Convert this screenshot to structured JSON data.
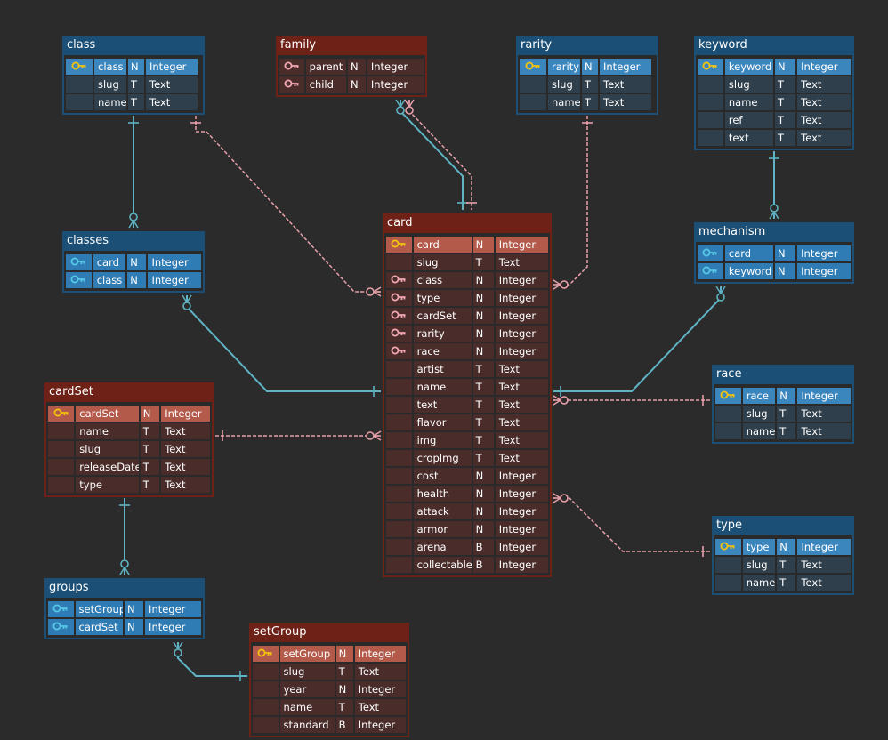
{
  "tables": [
    {
      "id": "class",
      "name": "class",
      "theme": "blue",
      "columns": [
        {
          "name": "class",
          "type": "N",
          "datatype": "Integer",
          "key": "pk"
        },
        {
          "name": "slug",
          "type": "T",
          "datatype": "Text",
          "key": ""
        },
        {
          "name": "name",
          "type": "T",
          "datatype": "Text",
          "key": ""
        }
      ]
    },
    {
      "id": "family",
      "name": "family",
      "theme": "red",
      "columns": [
        {
          "name": "parent",
          "type": "N",
          "datatype": "Integer",
          "key": "pkfk"
        },
        {
          "name": "child",
          "type": "N",
          "datatype": "Integer",
          "key": "fk"
        }
      ]
    },
    {
      "id": "rarity",
      "name": "rarity",
      "theme": "blue",
      "columns": [
        {
          "name": "rarity",
          "type": "N",
          "datatype": "Integer",
          "key": "pk"
        },
        {
          "name": "slug",
          "type": "T",
          "datatype": "Text",
          "key": ""
        },
        {
          "name": "name",
          "type": "T",
          "datatype": "Text",
          "key": ""
        }
      ]
    },
    {
      "id": "keyword",
      "name": "keyword",
      "theme": "blue",
      "columns": [
        {
          "name": "keyword",
          "type": "N",
          "datatype": "Integer",
          "key": "pk"
        },
        {
          "name": "slug",
          "type": "T",
          "datatype": "Text",
          "key": ""
        },
        {
          "name": "name",
          "type": "T",
          "datatype": "Text",
          "key": ""
        },
        {
          "name": "ref",
          "type": "T",
          "datatype": "Text",
          "key": ""
        },
        {
          "name": "text",
          "type": "T",
          "datatype": "Text",
          "key": ""
        }
      ]
    },
    {
      "id": "classes",
      "name": "classes",
      "theme": "blue",
      "columns": [
        {
          "name": "card",
          "type": "N",
          "datatype": "Integer",
          "key": "pkfk"
        },
        {
          "name": "class",
          "type": "N",
          "datatype": "Integer",
          "key": "pkfk"
        }
      ]
    },
    {
      "id": "card",
      "name": "card",
      "theme": "red",
      "columns": [
        {
          "name": "card",
          "type": "N",
          "datatype": "Integer",
          "key": "pk"
        },
        {
          "name": "slug",
          "type": "T",
          "datatype": "Text",
          "key": ""
        },
        {
          "name": "class",
          "type": "N",
          "datatype": "Integer",
          "key": "fk"
        },
        {
          "name": "type",
          "type": "N",
          "datatype": "Integer",
          "key": "fk"
        },
        {
          "name": "cardSet",
          "type": "N",
          "datatype": "Integer",
          "key": "fk"
        },
        {
          "name": "rarity",
          "type": "N",
          "datatype": "Integer",
          "key": "fk"
        },
        {
          "name": "race",
          "type": "N",
          "datatype": "Integer",
          "key": "fk"
        },
        {
          "name": "artist",
          "type": "T",
          "datatype": "Text",
          "key": ""
        },
        {
          "name": "name",
          "type": "T",
          "datatype": "Text",
          "key": ""
        },
        {
          "name": "text",
          "type": "T",
          "datatype": "Text",
          "key": ""
        },
        {
          "name": "flavor",
          "type": "T",
          "datatype": "Text",
          "key": ""
        },
        {
          "name": "img",
          "type": "T",
          "datatype": "Text",
          "key": ""
        },
        {
          "name": "cropImg",
          "type": "T",
          "datatype": "Text",
          "key": ""
        },
        {
          "name": "cost",
          "type": "N",
          "datatype": "Integer",
          "key": ""
        },
        {
          "name": "health",
          "type": "N",
          "datatype": "Integer",
          "key": ""
        },
        {
          "name": "attack",
          "type": "N",
          "datatype": "Integer",
          "key": ""
        },
        {
          "name": "armor",
          "type": "N",
          "datatype": "Integer",
          "key": ""
        },
        {
          "name": "arena",
          "type": "B",
          "datatype": "Integer",
          "key": ""
        },
        {
          "name": "collectable",
          "type": "B",
          "datatype": "Integer",
          "key": ""
        }
      ]
    },
    {
      "id": "mechanism",
      "name": "mechanism",
      "theme": "blue",
      "columns": [
        {
          "name": "card",
          "type": "N",
          "datatype": "Integer",
          "key": "pkfk"
        },
        {
          "name": "keyword",
          "type": "N",
          "datatype": "Integer",
          "key": "pkfk"
        }
      ]
    },
    {
      "id": "race",
      "name": "race",
      "theme": "blue",
      "columns": [
        {
          "name": "race",
          "type": "N",
          "datatype": "Integer",
          "key": "pk"
        },
        {
          "name": "slug",
          "type": "T",
          "datatype": "Text",
          "key": ""
        },
        {
          "name": "name",
          "type": "T",
          "datatype": "Text",
          "key": ""
        }
      ]
    },
    {
      "id": "cardSet",
      "name": "cardSet",
      "theme": "red",
      "columns": [
        {
          "name": "cardSet",
          "type": "N",
          "datatype": "Integer",
          "key": "pk"
        },
        {
          "name": "name",
          "type": "T",
          "datatype": "Text",
          "key": ""
        },
        {
          "name": "slug",
          "type": "T",
          "datatype": "Text",
          "key": ""
        },
        {
          "name": "releaseDate",
          "type": "T",
          "datatype": "Text",
          "key": ""
        },
        {
          "name": "type",
          "type": "T",
          "datatype": "Text",
          "key": ""
        }
      ]
    },
    {
      "id": "type",
      "name": "type",
      "theme": "blue",
      "columns": [
        {
          "name": "type",
          "type": "N",
          "datatype": "Integer",
          "key": "pk"
        },
        {
          "name": "slug",
          "type": "T",
          "datatype": "Text",
          "key": ""
        },
        {
          "name": "name",
          "type": "T",
          "datatype": "Text",
          "key": ""
        }
      ]
    },
    {
      "id": "groups",
      "name": "groups",
      "theme": "blue",
      "columns": [
        {
          "name": "setGroup",
          "type": "N",
          "datatype": "Integer",
          "key": "pkfk"
        },
        {
          "name": "cardSet",
          "type": "N",
          "datatype": "Integer",
          "key": "pkfk"
        }
      ]
    },
    {
      "id": "setGroup",
      "name": "setGroup",
      "theme": "red",
      "columns": [
        {
          "name": "setGroup",
          "type": "N",
          "datatype": "Integer",
          "key": "pk"
        },
        {
          "name": "slug",
          "type": "T",
          "datatype": "Text",
          "key": ""
        },
        {
          "name": "year",
          "type": "N",
          "datatype": "Integer",
          "key": ""
        },
        {
          "name": "name",
          "type": "T",
          "datatype": "Text",
          "key": ""
        },
        {
          "name": "standard",
          "type": "B",
          "datatype": "Integer",
          "key": ""
        }
      ]
    }
  ],
  "relationships": [
    {
      "from": "class",
      "to": "classes",
      "style": "identifying"
    },
    {
      "from": "class",
      "to": "card",
      "style": "non-identifying"
    },
    {
      "from": "family",
      "to": "card",
      "style": "identifying"
    },
    {
      "from": "family",
      "to": "card",
      "style": "non-identifying"
    },
    {
      "from": "rarity",
      "to": "card",
      "style": "non-identifying"
    },
    {
      "from": "keyword",
      "to": "mechanism",
      "style": "identifying"
    },
    {
      "from": "card",
      "to": "classes",
      "style": "identifying"
    },
    {
      "from": "card",
      "to": "mechanism",
      "style": "identifying"
    },
    {
      "from": "race",
      "to": "card",
      "style": "non-identifying"
    },
    {
      "from": "cardSet",
      "to": "card",
      "style": "non-identifying"
    },
    {
      "from": "type",
      "to": "card",
      "style": "non-identifying"
    },
    {
      "from": "cardSet",
      "to": "groups",
      "style": "identifying"
    },
    {
      "from": "setGroup",
      "to": "groups",
      "style": "identifying"
    }
  ],
  "colors": {
    "background": "#2b2b2b",
    "blue_header": "#1b4f75",
    "red_header": "#6e2116",
    "pk_key": "#f2c40f",
    "blue_fk_key": "#57c8e6",
    "red_fk_key": "#f3a6b4",
    "identifying_line": "#5fb3c4",
    "non_identifying_line": "#e8a0aa"
  },
  "icons": {
    "primary_key": "key-icon",
    "foreign_key": "key-icon"
  }
}
